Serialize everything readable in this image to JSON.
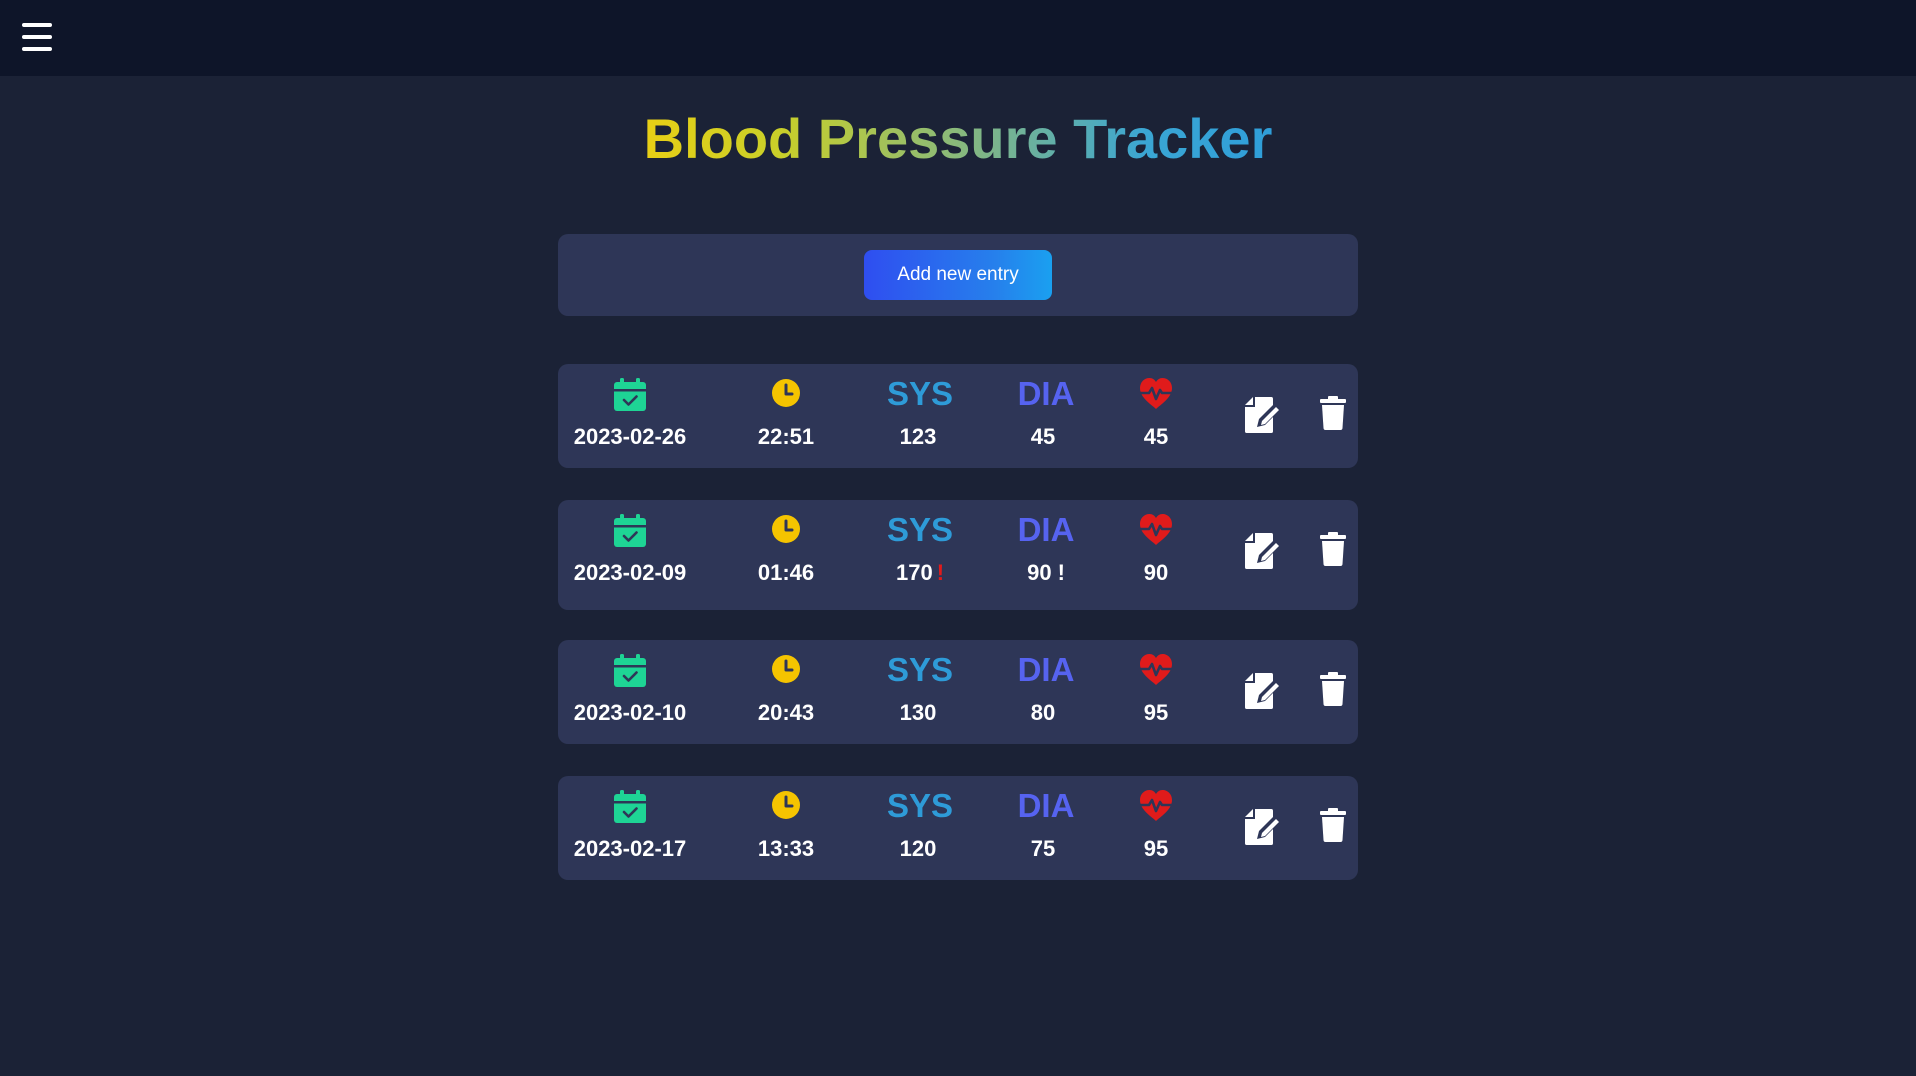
{
  "header": {
    "menu_icon": "hamburger-menu-icon"
  },
  "page": {
    "title": "Blood Pressure Tracker",
    "title_gradient": [
      "#e8cf15",
      "#7db58a",
      "#2f9ed9"
    ]
  },
  "add_entry": {
    "label": "Add new entry"
  },
  "columns": {
    "date_icon": "calendar-check-icon",
    "time_icon": "clock-icon",
    "sys_label": "SYS",
    "dia_label": "DIA",
    "pulse_icon": "heart-pulse-icon",
    "edit_icon": "edit-icon",
    "delete_icon": "trash-icon"
  },
  "colors": {
    "background": "#1b2236",
    "topbar": "#0e1529",
    "card": "#2e3657",
    "calendar": "#1ed495",
    "clock": "#f5c400",
    "sys": "#2e9bd8",
    "dia": "#5663f0",
    "heart": "#e01b1b",
    "warning": "#e01b1b"
  },
  "entries": [
    {
      "date": "2023-02-26",
      "time": "22:51",
      "sys": "123",
      "sys_warning": "",
      "dia": "45",
      "dia_warning": "",
      "pulse": "45"
    },
    {
      "date": "2023-02-09",
      "time": "01:46",
      "sys": "170",
      "sys_warning": "!",
      "dia": "90",
      "dia_warning": "!",
      "pulse": "90"
    },
    {
      "date": "2023-02-10",
      "time": "20:43",
      "sys": "130",
      "sys_warning": "",
      "dia": "80",
      "dia_warning": "",
      "pulse": "95"
    },
    {
      "date": "2023-02-17",
      "time": "13:33",
      "sys": "120",
      "sys_warning": "",
      "dia": "75",
      "dia_warning": "",
      "pulse": "95"
    }
  ]
}
